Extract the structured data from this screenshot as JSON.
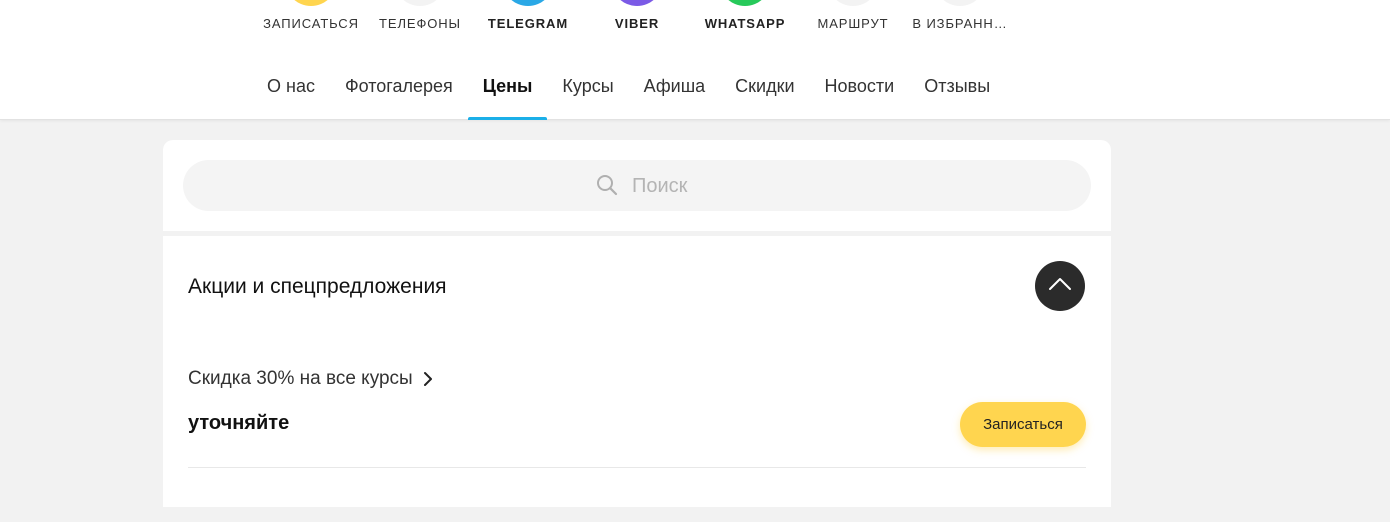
{
  "actions": [
    {
      "label": "Записаться",
      "icon": "calendar-icon",
      "color": "#ffd54f",
      "bold": false
    },
    {
      "label": "Телефоны",
      "icon": "phone-icon",
      "color": "#f3f3f3",
      "bold": false
    },
    {
      "label": "Telegram",
      "icon": "telegram-icon",
      "color": "#2aa8e6",
      "bold": true
    },
    {
      "label": "Viber",
      "icon": "viber-icon",
      "color": "#7b5ae6",
      "bold": true
    },
    {
      "label": "WhatsApp",
      "icon": "whatsapp-icon",
      "color": "#27c95a",
      "bold": true
    },
    {
      "label": "Маршрут",
      "icon": "route-icon",
      "color": "#f3f3f3",
      "bold": false
    },
    {
      "label": "В избранн…",
      "icon": "bookmark-icon",
      "color": "#f3f3f3",
      "bold": false
    }
  ],
  "tabs": [
    {
      "label": "О нас",
      "active": false
    },
    {
      "label": "Фотогалерея",
      "active": false
    },
    {
      "label": "Цены",
      "active": true
    },
    {
      "label": "Курсы",
      "active": false
    },
    {
      "label": "Афиша",
      "active": false
    },
    {
      "label": "Скидки",
      "active": false
    },
    {
      "label": "Новости",
      "active": false
    },
    {
      "label": "Отзывы",
      "active": false
    }
  ],
  "accent_color": "#1bafe8",
  "search": {
    "placeholder": "Поиск",
    "value": ""
  },
  "section": {
    "title": "Акции и спецпредложения",
    "items": [
      {
        "name": "Скидка 30% на все курсы",
        "price": "уточняйте",
        "button_label": "Записаться"
      }
    ]
  }
}
